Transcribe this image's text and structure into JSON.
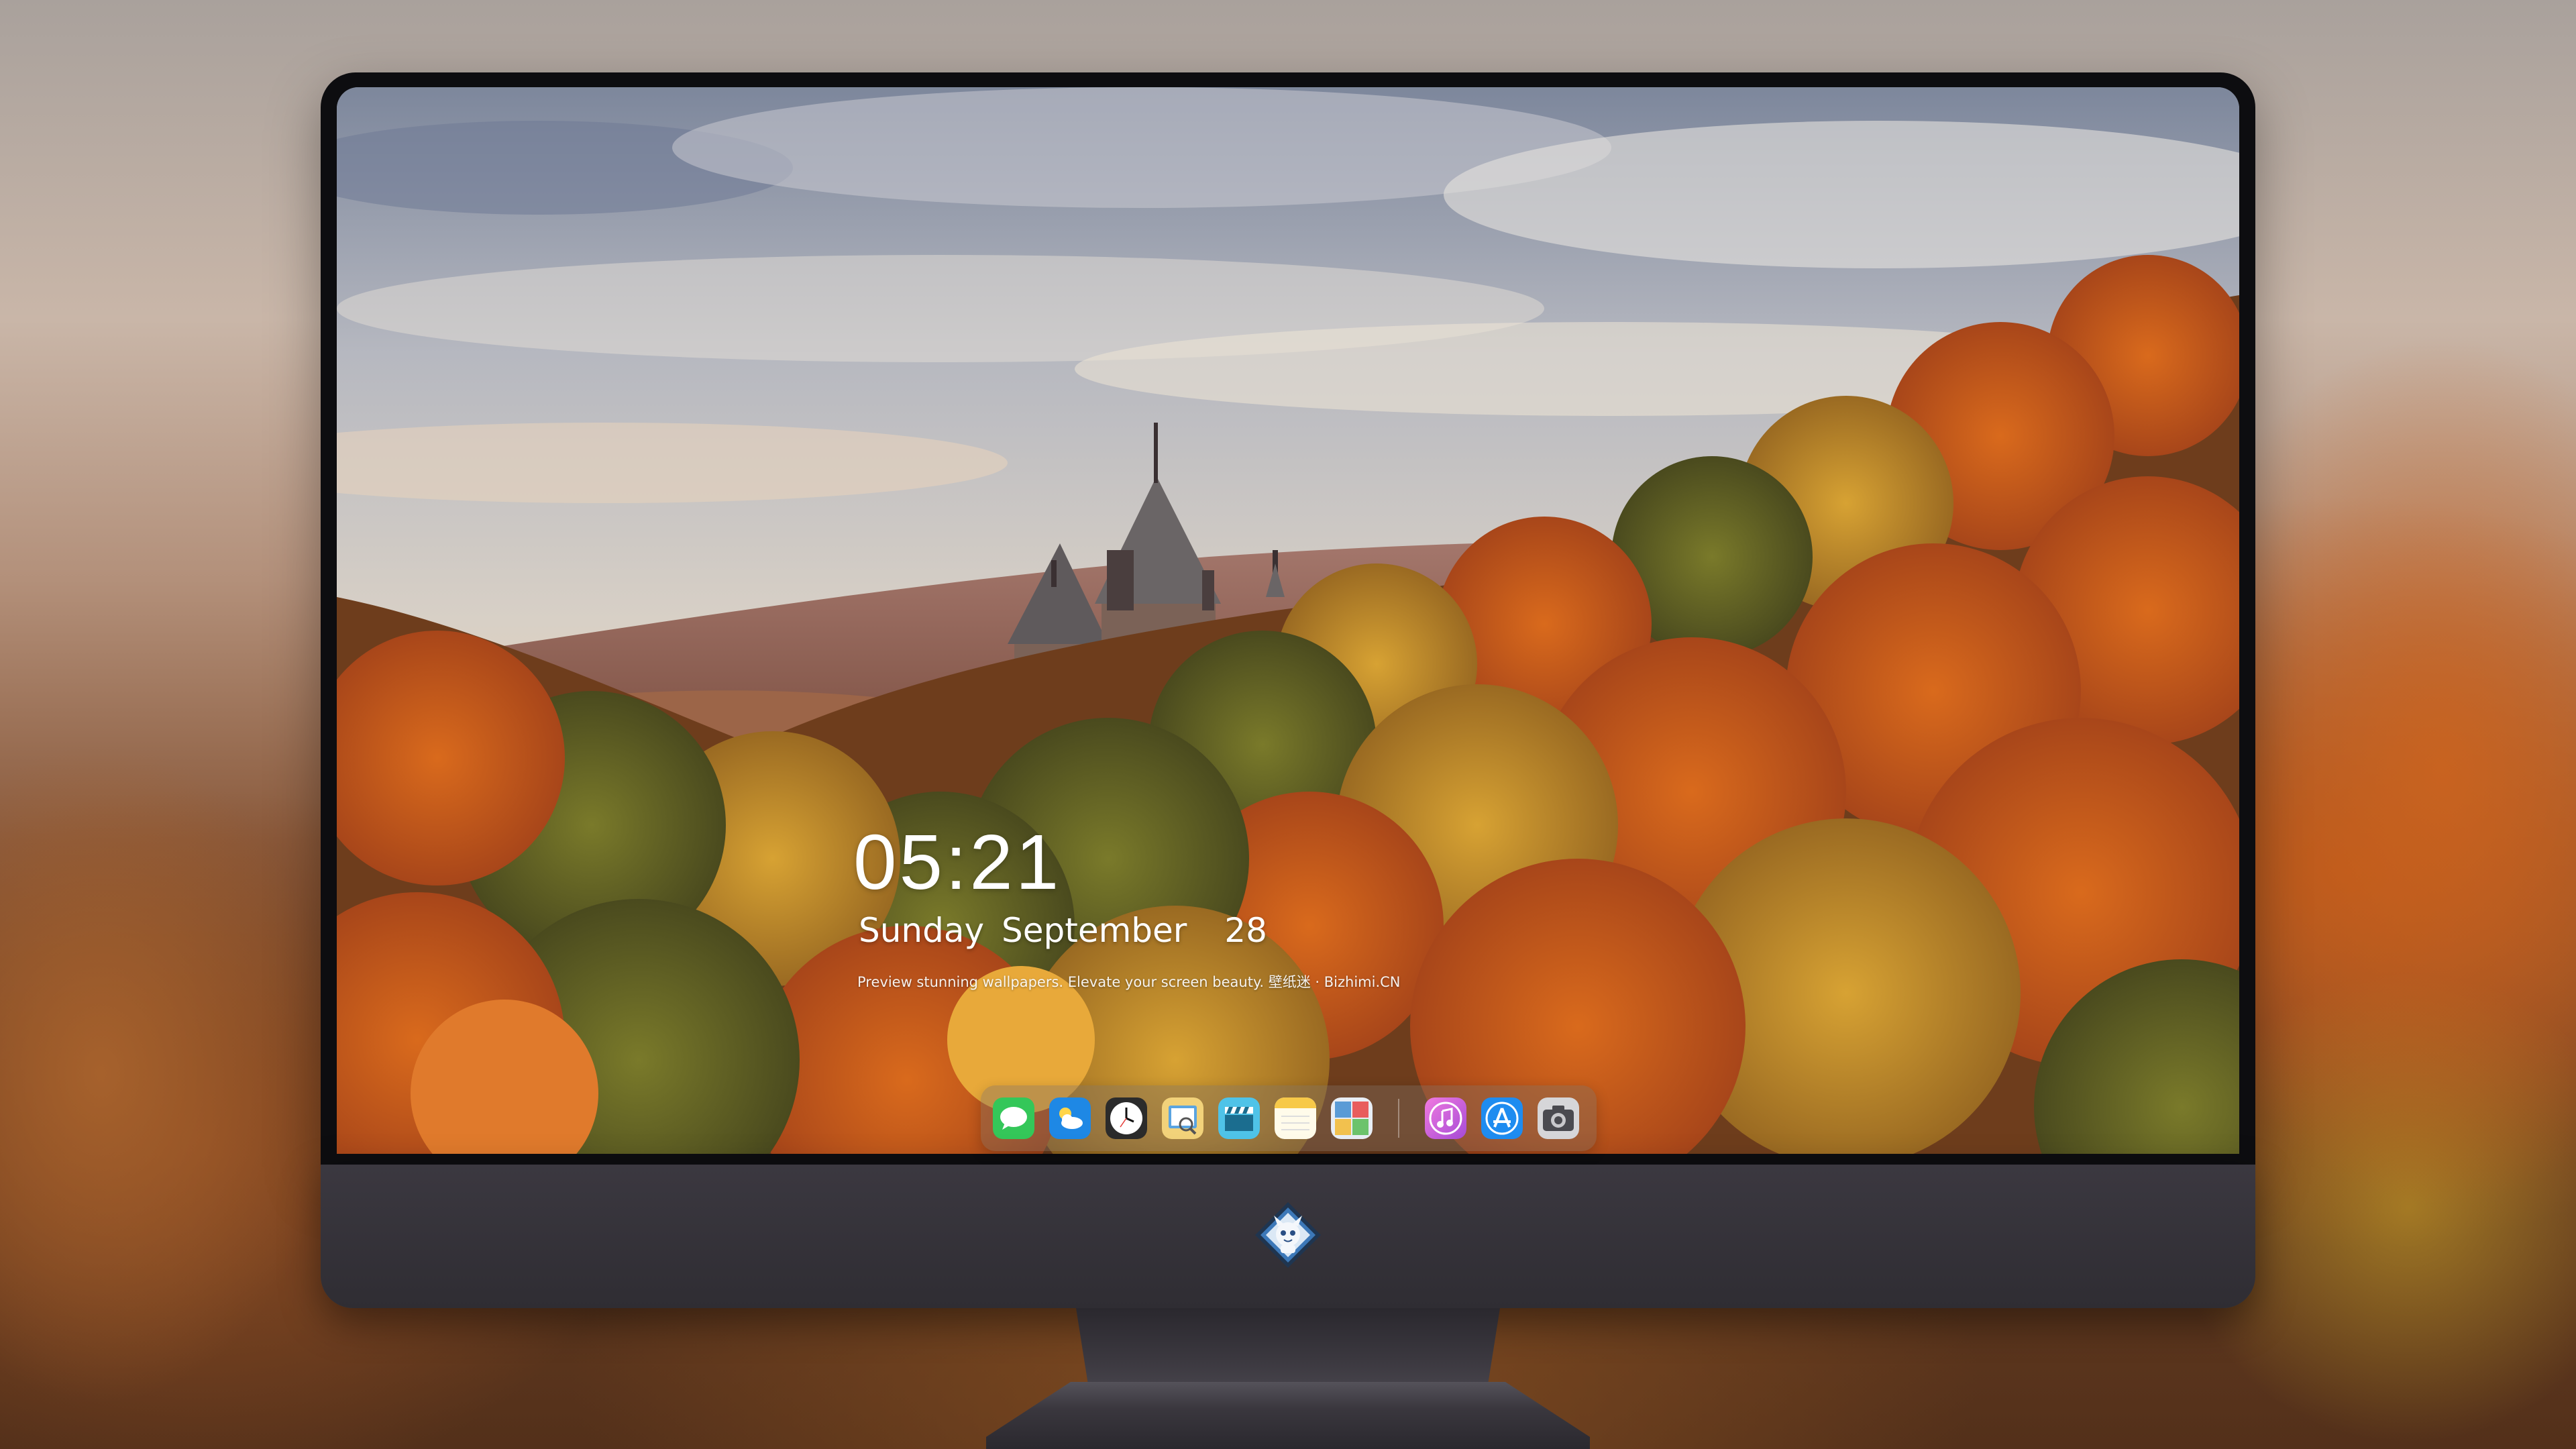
{
  "lock_screen": {
    "time": "05:21",
    "weekday": "Sunday",
    "month": "September",
    "day": "28",
    "tagline": "Preview stunning wallpapers. Elevate your screen beauty. 壁纸迷 · Bizhimi.CN"
  },
  "dock": {
    "apps": [
      {
        "name": "Messages",
        "icon": "messages-icon",
        "color": "#34c759"
      },
      {
        "name": "Weather",
        "icon": "weather-icon",
        "color": "#1e88e5"
      },
      {
        "name": "Clock",
        "icon": "clock-icon",
        "color": "#ffffff"
      },
      {
        "name": "Preview",
        "icon": "preview-icon",
        "color": "#e8c35a"
      },
      {
        "name": "Clips",
        "icon": "clapperboard-icon",
        "color": "#4fc3e8"
      },
      {
        "name": "Notes",
        "icon": "notes-icon",
        "color": "#f7c948"
      },
      {
        "name": "Photo Booth",
        "icon": "photo-gallery-icon",
        "color": "#5a9bd6"
      },
      {
        "name": "iTunes",
        "icon": "music-note-icon",
        "color": "#d65bd8"
      },
      {
        "name": "App Store",
        "icon": "app-store-icon",
        "color": "#1e8cf0"
      },
      {
        "name": "Screenshot",
        "icon": "camera-icon",
        "color": "#8e8e93"
      }
    ]
  },
  "monitor": {
    "logo": "mascot-logo-icon",
    "bezel_color": "#0d0d10",
    "chin_color": "#35333a"
  }
}
